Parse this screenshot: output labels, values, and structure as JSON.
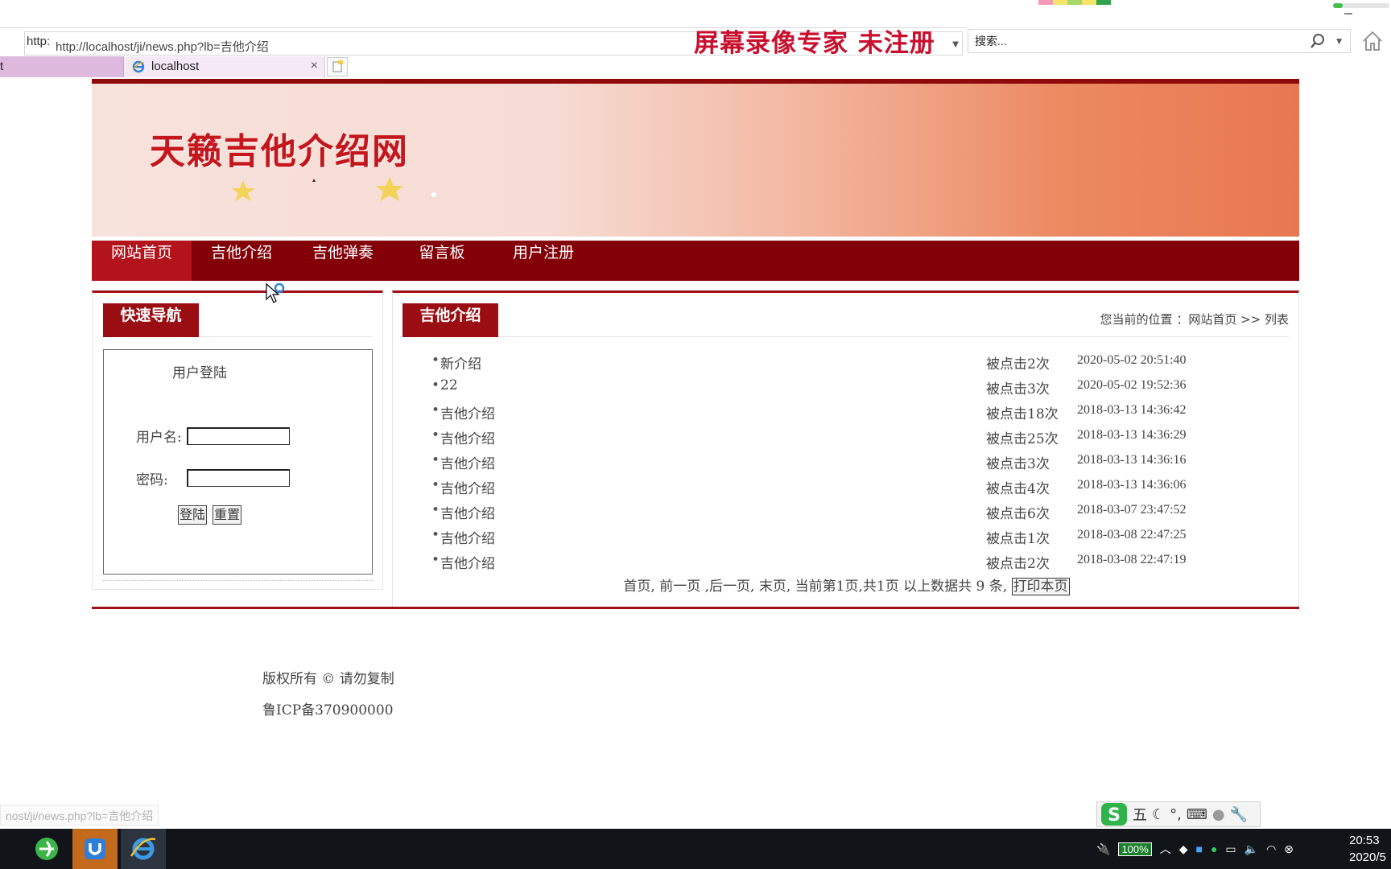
{
  "browser": {
    "address_prefix": "http:",
    "url": "http://localhost/ji/news.php?lb=吉他介绍",
    "watermark": "屏幕录像专家  未注册",
    "search_placeholder": "搜索...",
    "prev_tab_label": "t",
    "tab_title": "localhost",
    "tab_close": "×",
    "status_hint": "nost/ji/news.php?lb=吉他介绍",
    "colors": {
      "tab_active": "#f6e9f6",
      "tab_prev": "#dcb9dd"
    }
  },
  "site": {
    "banner_title": "天籁吉他介绍网",
    "nav": [
      {
        "label": "网站首页",
        "active": true
      },
      {
        "label": "吉他介绍",
        "active": false
      },
      {
        "label": "吉他弹奏",
        "active": false
      },
      {
        "label": "留言板",
        "active": false
      },
      {
        "label": "用户注册",
        "active": false
      }
    ],
    "colors": {
      "nav_bg": "#830008",
      "nav_active": "#b3141c",
      "accent": "#a01018",
      "banner_title": "#c4161c"
    }
  },
  "sidebar": {
    "heading": "快速导航",
    "login": {
      "title": "用户登陆",
      "username_label": "用户名:",
      "username_value": "",
      "password_label": "密码:",
      "password_value": "",
      "login_button": "登陆",
      "reset_button": "重置"
    }
  },
  "main": {
    "heading": "吉他介绍",
    "breadcrumb": "您当前的位置 ：网站首页 >> 列表",
    "articles": [
      {
        "title": "新介绍",
        "hits": "被点击2次",
        "time": "2020-05-02 20:51:40"
      },
      {
        "title": "22",
        "hits": "被点击3次",
        "time": "2020-05-02 19:52:36"
      },
      {
        "title": "吉他介绍",
        "hits": "被点击18次",
        "time": "2018-03-13 14:36:42"
      },
      {
        "title": "吉他介绍",
        "hits": "被点击25次",
        "time": "2018-03-13 14:36:29"
      },
      {
        "title": "吉他介绍",
        "hits": "被点击3次",
        "time": "2018-03-13 14:36:16"
      },
      {
        "title": "吉他介绍",
        "hits": "被点击4次",
        "time": "2018-03-13 14:36:06"
      },
      {
        "title": "吉他介绍",
        "hits": "被点击6次",
        "time": "2018-03-07 23:47:52"
      },
      {
        "title": "吉他介绍",
        "hits": "被点击1次",
        "time": "2018-03-08 22:47:25"
      },
      {
        "title": "吉他介绍",
        "hits": "被点击2次",
        "time": "2018-03-08 22:47:19"
      }
    ],
    "pager": {
      "first": "首页,",
      "prev": "前一页",
      "next": ",后一页,",
      "last": "末页,",
      "info": "当前第1页,共1页",
      "count": "以上数据共 9 条,",
      "print_button": "打印本页"
    }
  },
  "footer": {
    "copyright": "版权所有 © 请勿复制",
    "icp": "鲁ICP备370900000"
  },
  "ime": {
    "mode": "五"
  },
  "taskbar": {
    "battery": "100%",
    "time": "20:53",
    "date": "2020/5"
  }
}
